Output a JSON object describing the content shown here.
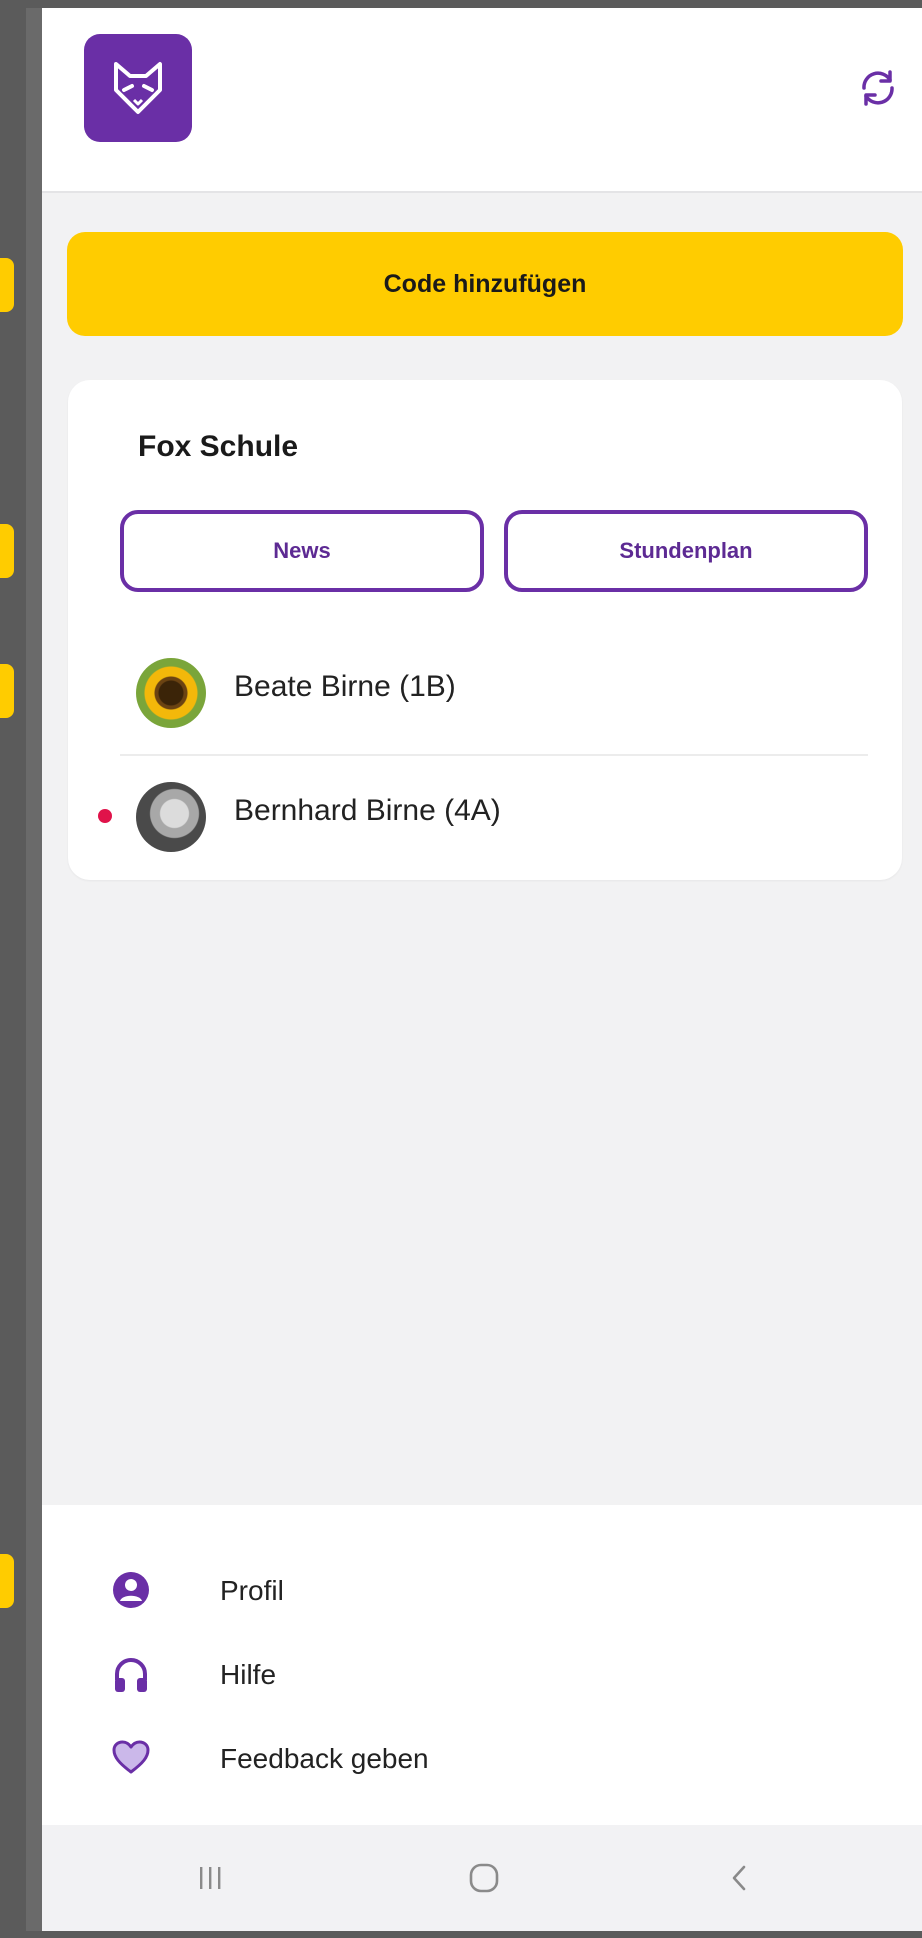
{
  "actions": {
    "add_code_label": "Code hinzufügen"
  },
  "school": {
    "name": "Fox Schule",
    "buttons": {
      "news": "News",
      "schedule": "Stundenplan"
    },
    "students": [
      {
        "name": "Beate Birne (1B)",
        "unread": false
      },
      {
        "name": "Bernhard Birne (4A)",
        "unread": true
      }
    ]
  },
  "menu": {
    "items": [
      {
        "label": "Profil",
        "icon": "user-circle-icon"
      },
      {
        "label": "Hilfe",
        "icon": "headphones-icon"
      },
      {
        "label": "Feedback geben",
        "icon": "heart-icon"
      }
    ]
  },
  "colors": {
    "brand_purple": "#6a2fa6",
    "accent_yellow": "#ffcc00",
    "notification_red": "#e0134a"
  }
}
